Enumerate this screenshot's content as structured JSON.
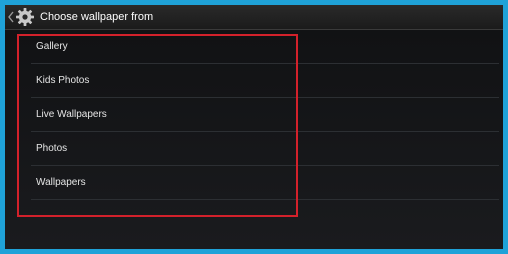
{
  "header": {
    "title": "Choose wallpaper from",
    "icon": "gear-icon",
    "back_icon": "chevron-left-icon"
  },
  "wallpaper_sources": [
    {
      "label": "Gallery"
    },
    {
      "label": "Kids Photos"
    },
    {
      "label": "Live Wallpapers"
    },
    {
      "label": "Photos"
    },
    {
      "label": "Wallpapers"
    }
  ],
  "colors": {
    "frame_border": "#1fa2d8",
    "highlight": "#d3212b",
    "background": "#111214"
  }
}
